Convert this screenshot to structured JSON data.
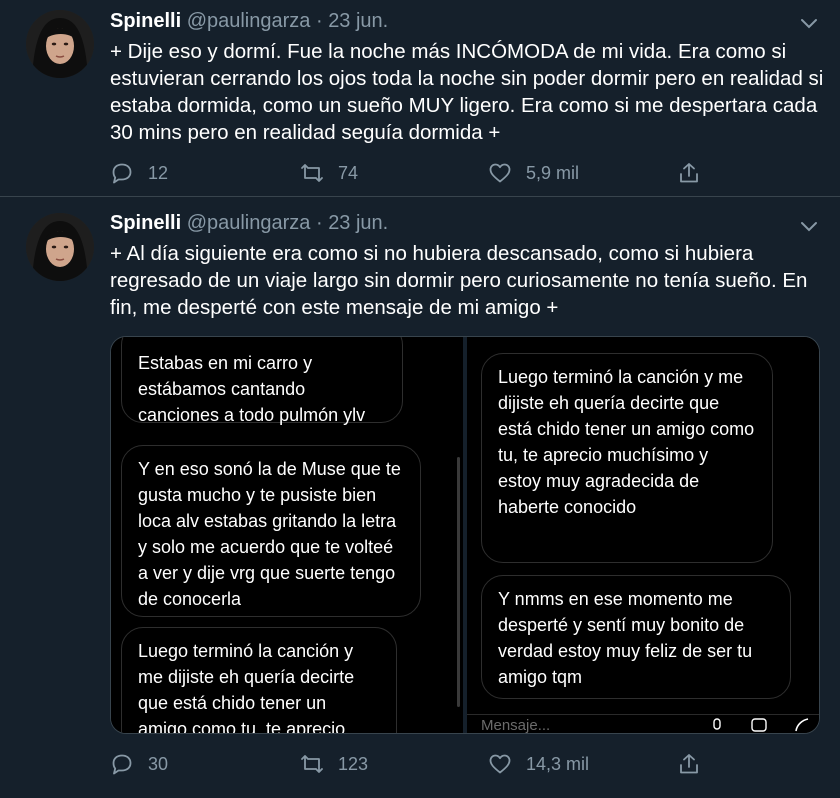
{
  "tweets": [
    {
      "name": "Spinelli",
      "handle": "@paulingarza",
      "date": "23 jun.",
      "text": "+ Dije eso y dormí. Fue la noche más INCÓMODA de mi vida. Era como si estuvieran cerrando los ojos toda la noche sin poder dormir pero en realidad si estaba dormida, como un sueño MUY ligero. Era como si me despertara cada 30 mins pero en realidad seguía dormida +",
      "replies": "12",
      "retweets": "74",
      "likes": "5,9 mil"
    },
    {
      "name": "Spinelli",
      "handle": "@paulingarza",
      "date": "23 jun.",
      "text": "+ Al día siguiente era como si no hubiera descansado, como si hubiera regresado de un viaje largo sin dormir pero curiosamente no tenía sueño. En fin, me desperté con este mensaje de mi amigo +",
      "replies": "30",
      "retweets": "123",
      "likes": "14,3 mil",
      "media": {
        "left_bubbles": [
          "Estabas en mi carro y estábamos cantando canciones a todo pulmón ylv",
          "Y en eso sonó la de Muse que te gusta mucho y te pusiste bien loca alv estabas gritando la letra y solo me acuerdo que te volteé a ver y dije vrg que suerte tengo de conocerla",
          "Luego terminó la canción y me dijiste eh quería decirte que está chido tener un amigo como tu, te aprecio"
        ],
        "right_bubbles": [
          "Luego terminó la canción y me dijiste eh quería decirte que está chido tener un amigo como tu, te aprecio muchísimo y estoy muy agradecida de haberte conocido",
          "Y nmms en ese momento me desperté y sentí muy bonito de verdad estoy muy feliz de ser tu amigo tqm"
        ],
        "input_placeholder": "Mensaje..."
      }
    }
  ],
  "colors": {
    "background": "#15202b",
    "secondary_text": "#8899a6",
    "divider": "#38444d"
  },
  "icons": [
    "avatar",
    "chevron-down-icon",
    "reply-icon",
    "retweet-icon",
    "like-icon",
    "share-icon"
  ]
}
